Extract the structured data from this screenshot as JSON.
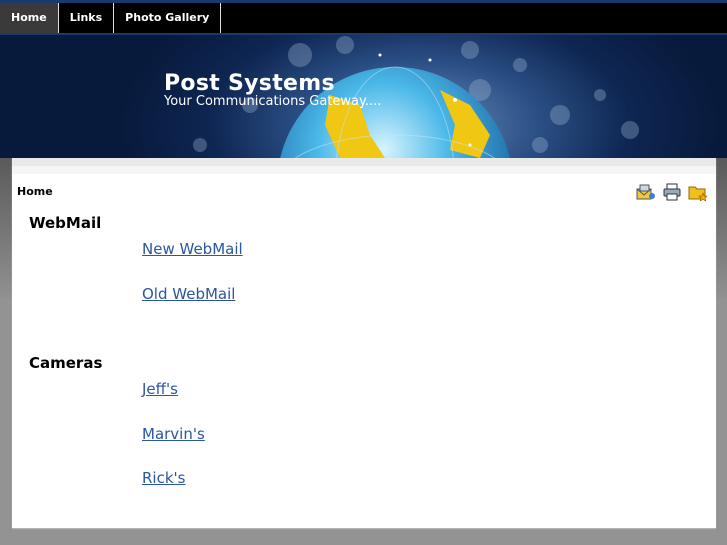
{
  "nav": {
    "items": [
      {
        "label": "Home",
        "active": true
      },
      {
        "label": "Links",
        "active": false
      },
      {
        "label": "Photo Gallery",
        "active": false
      }
    ]
  },
  "banner": {
    "title": "Post Systems",
    "subtitle": "Your Communications Gateway...."
  },
  "breadcrumb": "Home",
  "toolbar_icons": [
    "email-icon",
    "print-icon",
    "bookmark-folder-icon"
  ],
  "sections": [
    {
      "heading": "WebMail",
      "links": [
        "New WebMail",
        "Old WebMail"
      ]
    },
    {
      "heading": "Cameras",
      "links": [
        "Jeff's",
        "Marvin's",
        "Rick's"
      ]
    }
  ],
  "colors": {
    "link": "#2b56a0",
    "nav_bg": "#000000",
    "active_tab": "#3a3a3a"
  }
}
